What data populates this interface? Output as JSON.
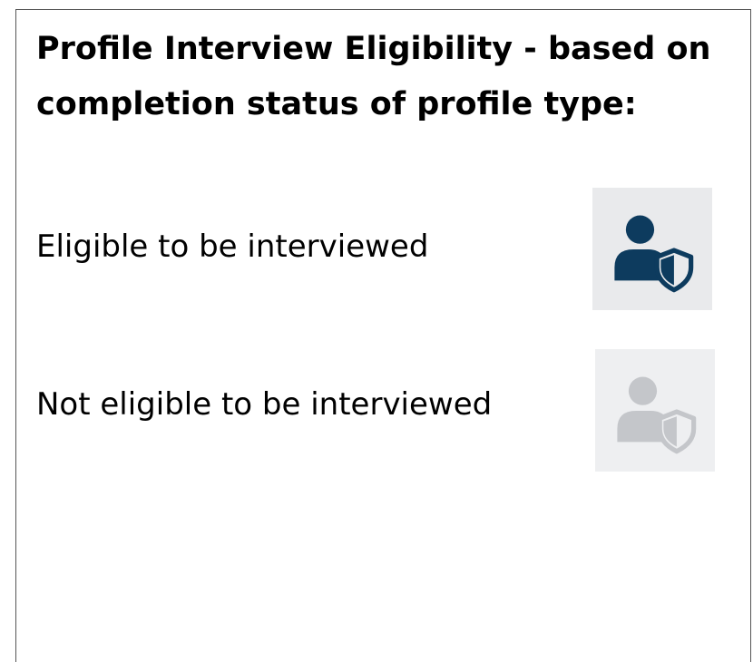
{
  "legend": {
    "title": "Profile Interview Eligibility - based on completion status of profile type:",
    "rows": [
      {
        "label": "Eligible to be interviewed",
        "icon": "user-shield-icon",
        "icon_color": "#0d3b5e"
      },
      {
        "label": "Not eligible to be interviewed",
        "icon": "user-shield-icon",
        "icon_color": "#c4c6ca"
      }
    ]
  }
}
